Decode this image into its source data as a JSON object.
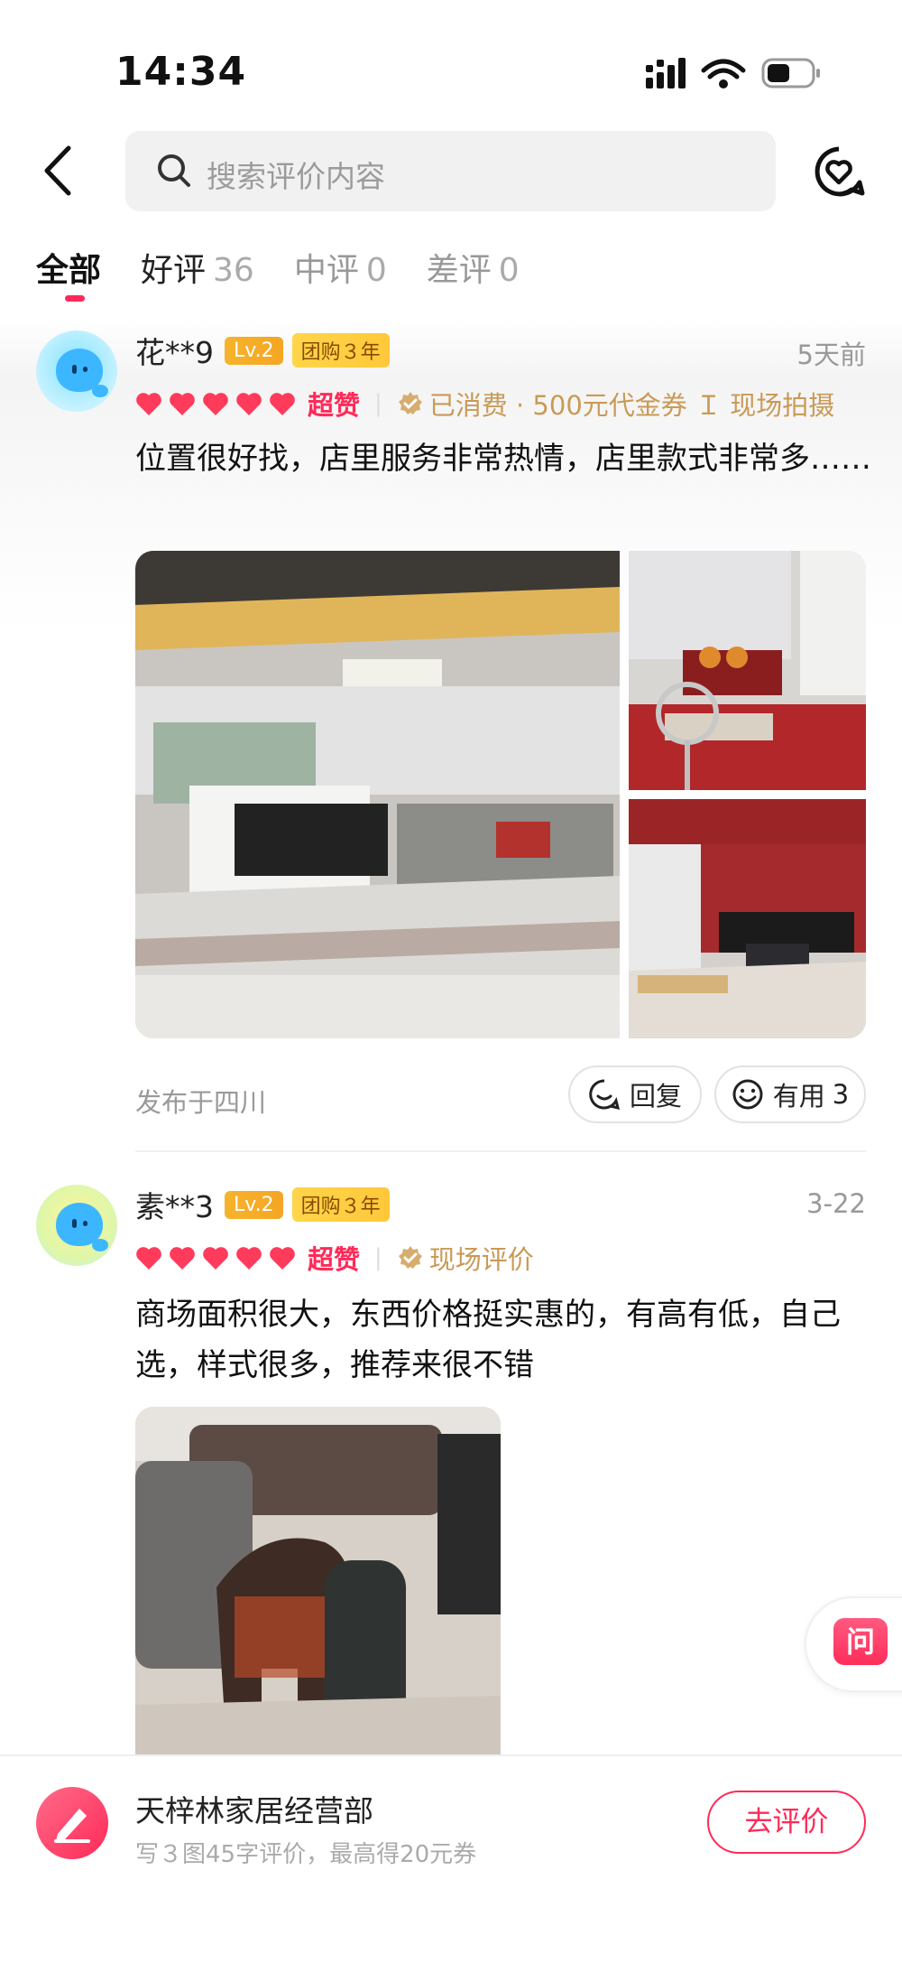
{
  "status_bar": {
    "time": "14:34"
  },
  "search": {
    "placeholder": "搜索评价内容"
  },
  "tabs": [
    {
      "label": "全部",
      "count": ""
    },
    {
      "label": "好评",
      "count": "36"
    },
    {
      "label": "中评",
      "count": "0"
    },
    {
      "label": "差评",
      "count": "0"
    }
  ],
  "reviews": [
    {
      "user": "花**9",
      "level": "Lv.2",
      "tuangou": "团购３年",
      "date": "5天前",
      "rating_word": "超赞",
      "meta": "已消费 · 500元代金券 Ｉ 现场拍摄",
      "text": "位置很好找，店里服务非常热情，店里款式非常多……",
      "published": "发布于四川",
      "reply_label": "回复",
      "useful_label": "有用",
      "useful_count": "3"
    },
    {
      "user": "素**3",
      "level": "Lv.2",
      "tuangou": "团购３年",
      "date": "3-22",
      "rating_word": "超赞",
      "meta": "现场评价",
      "text": "商场面积很大，东西价格挺实惠的，有高有低，自己选，样式很多，推荐来很不错"
    }
  ],
  "float": {
    "ask_label": "问"
  },
  "bottom_bar": {
    "shop_name": "天梓林家居经营部",
    "subtitle": "写３图45字评价，最高得20元券",
    "button": "去评价"
  },
  "colors": {
    "accent": "#ff2a58",
    "gold": "#c99a57",
    "badge": "#f5a623"
  }
}
